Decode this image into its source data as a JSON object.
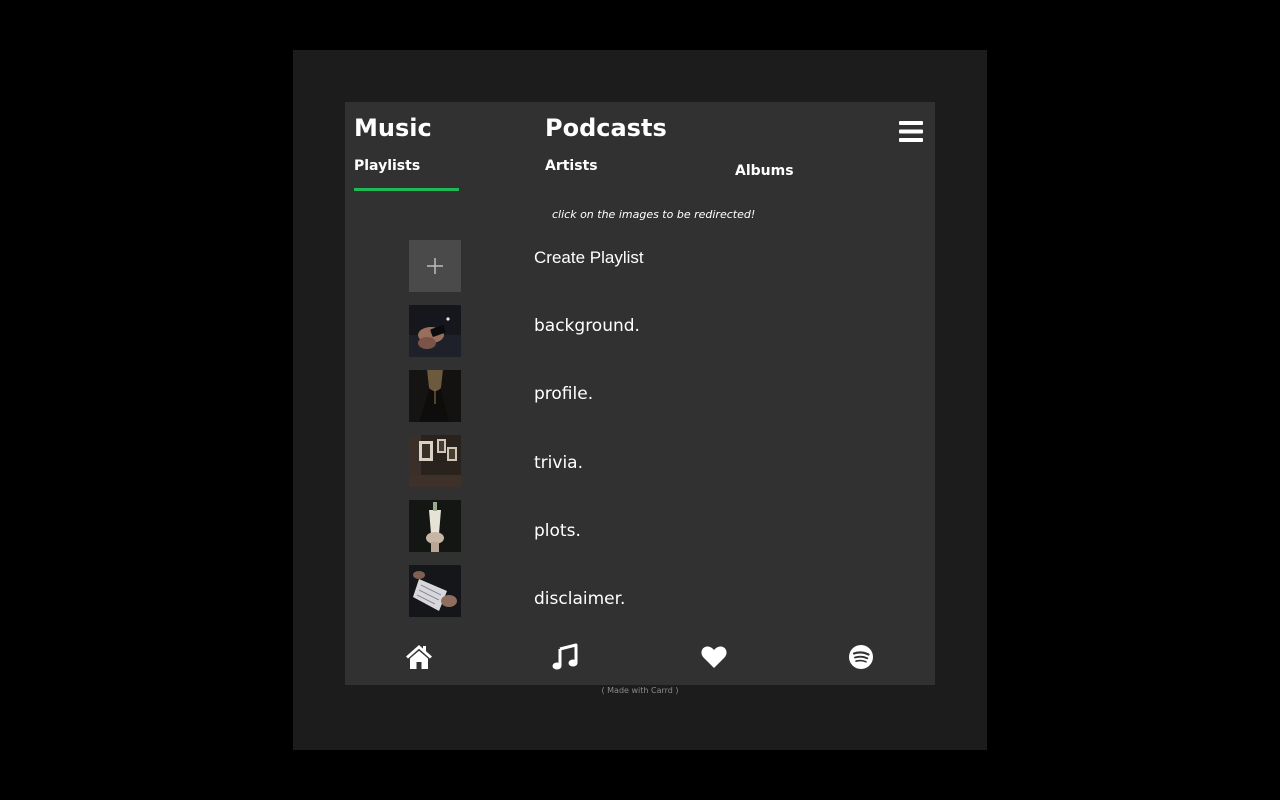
{
  "header": {
    "music_title": "Music",
    "podcasts_title": "Podcasts",
    "tabs": [
      {
        "label": "Playlists",
        "active": true
      },
      {
        "label": "Artists",
        "active": false
      },
      {
        "label": "Albums",
        "active": false
      }
    ],
    "menu_icon": "hamburger-menu-icon"
  },
  "hint": "click on the images to be redirected!",
  "playlists": [
    {
      "label": "Create Playlist",
      "icon": "plus-icon"
    },
    {
      "label": "background."
    },
    {
      "label": "profile."
    },
    {
      "label": "trivia."
    },
    {
      "label": "plots."
    },
    {
      "label": "disclaimer."
    }
  ],
  "bottom_nav": [
    {
      "icon": "home-icon"
    },
    {
      "icon": "music-note-icon"
    },
    {
      "icon": "heart-icon"
    },
    {
      "icon": "spotify-icon"
    }
  ],
  "footer": "( Made with Carrd )",
  "colors": {
    "accent": "#1db954",
    "page_background": "#000000",
    "frame_background": "#1c1c1c",
    "card_background": "#313131"
  }
}
